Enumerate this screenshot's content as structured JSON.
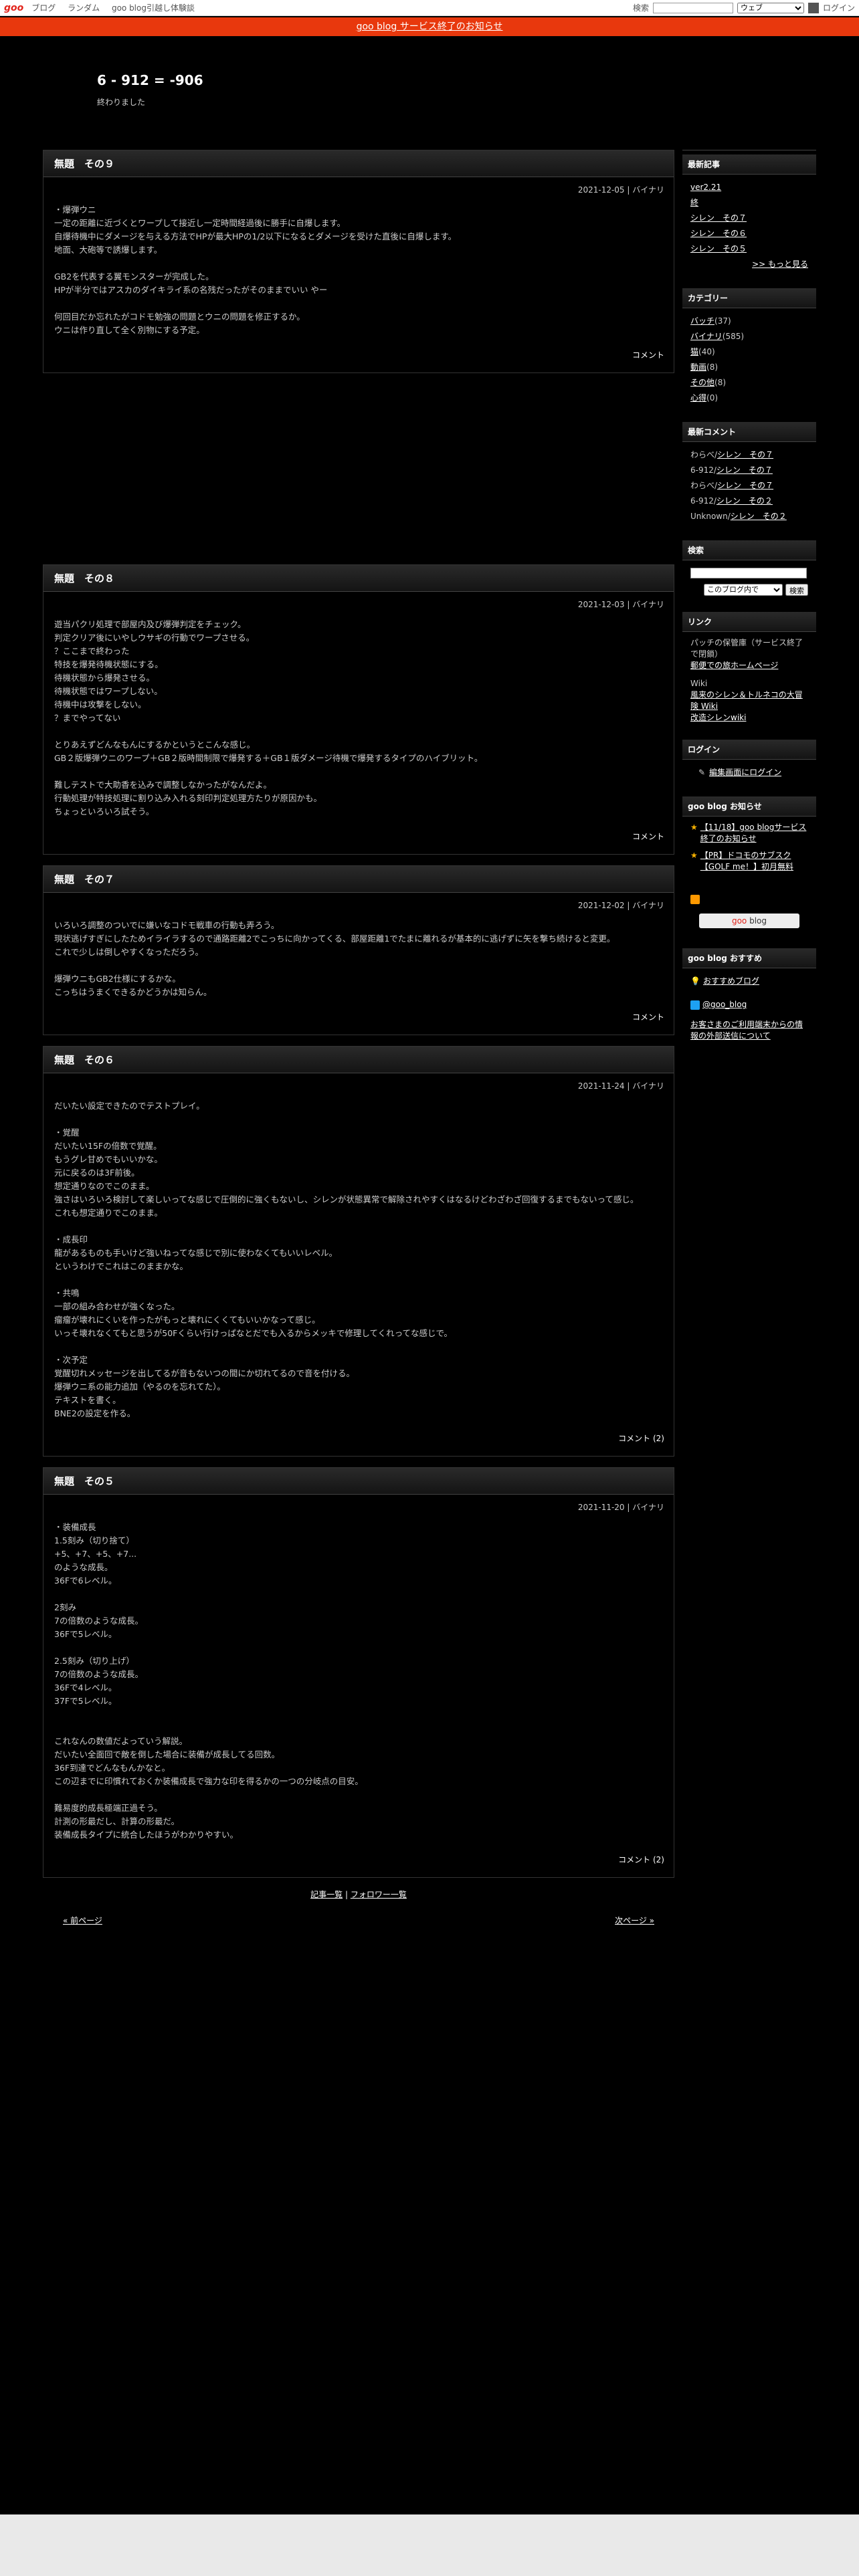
{
  "topbar": {
    "logo": "goo",
    "nav": [
      "ブログ",
      "ランダム",
      "goo blog引越し体験談"
    ],
    "search_label": "検索",
    "search_scope": "ウェブ",
    "login": "ログイン"
  },
  "notice": "goo blog サービス終了のお知らせ",
  "blog": {
    "title": "6 - 912 = -906",
    "description": "終わりました"
  },
  "entries": [
    {
      "title": "無題　その９",
      "meta": "2021-12-05 | バイナリ",
      "body": "・爆弾ウニ\n一定の距離に近づくとワープして接近し一定時間経過後に勝手に自爆します。\n自爆待機中にダメージを与える方法でHPが最大HPの1/2以下になるとダメージを受けた直後に自爆します。\n地面、大砲等で誘爆します。\n\nGB2を代表する翼モンスターが完成した。\nHPが半分ではアスカのダイキライ系の名残だったがそのままでいい やー\n\n何回目だか忘れたがコドモ勉強の問題とウニの問題を修正するか。\nウニは作り直して全く別物にする予定。",
      "footer": "コメント"
    },
    {
      "title": "無題　その８",
      "meta": "2021-12-03 | バイナリ",
      "body": "遊当パクリ処理で部屋内及び爆弾判定をチェック。\n判定クリア後にいやしウサギの行動でワープさせる。\n？ここまで終わった\n特技を爆発待機状態にする。\n待機状態から爆発させる。\n待機状態ではワープしない。\n待機中は攻撃をしない。\n？までやってない\n\nとりあえずどんなもんにするかというとこんな感じ。\nGB２版爆弾ウニのワープ＋GB２版時間制限で爆発する＋GB１版ダメージ待機で爆発するタイプのハイブリット。\n\n難しテストで大助香を込みで調整しなかったがなんだよ。\n行動処理が特技処理に割り込み入れる刻印判定処理方たりが原因かも。\nちょっといろいろ試そう。",
      "footer": "コメント"
    },
    {
      "title": "無題　その７",
      "meta": "2021-12-02 | バイナリ",
      "body": "いろいろ調整のついでに嫌いなコドモ戦車の行動も弄ろう。\n現状逃げすぎにしたためイライラするので通路距離2でこっちに向かってくる、部屋距離1でたまに離れるが基本的に逃げずに矢を撃ち続けると変更。\nこれで少しは倒しやすくなっただろう。\n\n爆弾ウニもGB2仕様にするかな。\nこっちはうまくできるかどうかは知らん。",
      "footer": "コメント"
    },
    {
      "title": "無題　その６",
      "meta": "2021-11-24 | バイナリ",
      "body": "だいたい設定できたのでテストプレイ。\n\n・覚醒\nだいたい15Fの倍数で覚醒。\nもうグレ甘めでもいいかな。\n元に戻るのは3F前後。\n想定通りなのでこのまま。\n強さはいろいろ検討して楽しいってな感じで圧倒的に強くもないし、シレンが状態異常で解除されやすくはなるけどわざわざ回復するまでもないって感じ。\nこれも想定通りでこのまま。\n\n・成長印\n龍があるものも手いけど強いねってな感じで別に使わなくてもいいレベル。\nというわけでこれはこのままかな。\n\n・共鳴\n一部の組み合わせが強くなった。\n瘤瘤が壊れにくいを作ったがもっと壊れにくくてもいいかなって感じ。\nいっそ壊れなくてもと思うが50Fくらい行けっぱなとだでも入るからメッキで修理してくれってな感じで。\n\n・次予定\n覚醒切れメッセージを出してるが音もないつの間にか切れてるので音を付ける。\n爆弾ウニ系の能力追加（やるのを忘れてた）。\nテキストを書く。\nBNE2の設定を作る。",
      "footer": "コメント (2)"
    },
    {
      "title": "無題　その５",
      "meta": "2021-11-20 | バイナリ",
      "body": "・装備成長\n1.5刻み（切り捨て）\n+5、+7、+5、+7...\nのような成長。\n36Fで6レベル。\n\n2刻み\n7の倍数のような成長。\n36Fで5レベル。\n\n2.5刻み（切り上げ）\n7の倍数のような成長。\n36Fで4レベル。\n37Fで5レベル。\n\n\nこれなんの数値だよっていう解説。\nだいたい全面回で敵を倒した場合に装備が成長してる回数。\n36F到達でどんなもんかなと。\nこの辺までに印慣れておくか装備成長で強力な印を得るかの一つの分岐点の目安。\n\n難易度的成長極端正過そう。\n計測の形最だし、計算の形最だ。\n装備成長タイプに統合したほうがわかりやすい。",
      "footer": "コメント (2)"
    }
  ],
  "bottom_links": {
    "list": "記事一覧",
    "sep": "|",
    "follow": "フォロワー一覧"
  },
  "pager": {
    "prev": "« 前ページ",
    "next": "次ページ »"
  },
  "sidebar": {
    "recent": {
      "title": "最新記事",
      "items": [
        "ver2.21",
        "終",
        "シレン　その７",
        "シレン　その６",
        "シレン　その５"
      ],
      "more": ">> もっと見る"
    },
    "categories": {
      "title": "カテゴリー",
      "items": [
        {
          "name": "バッチ",
          "count": "(37)"
        },
        {
          "name": "バイナリ",
          "count": "(585)"
        },
        {
          "name": "猫",
          "count": "(40)"
        },
        {
          "name": "動画",
          "count": "(8)"
        },
        {
          "name": "その他",
          "count": "(8)"
        },
        {
          "name": "心得",
          "count": "(0)"
        }
      ]
    },
    "comments": {
      "title": "最新コメント",
      "items": [
        {
          "who": "わらべ/",
          "post": "シレン　その７"
        },
        {
          "who": "6-912/",
          "post": "シレン　その７"
        },
        {
          "who": "わらべ/",
          "post": "シレン　その７"
        },
        {
          "who": "6-912/",
          "post": "シレン　その２"
        },
        {
          "who": "Unknown/",
          "post": "シレン　その２"
        }
      ]
    },
    "search": {
      "title": "検索",
      "scope": "このブログ内で",
      "button": "検索"
    },
    "links": {
      "title": "リンク",
      "lines": [
        "パッチの保管庫（サービス終了で閉鎖）",
        "郵便での旅ホームページ",
        "Wiki",
        "風来のシレン＆トルネコの大冒険 Wiki",
        "改造シレンwiki"
      ]
    },
    "login": {
      "title": "ログイン",
      "link": "編集画面にログイン"
    },
    "news": {
      "title": "goo blog お知らせ",
      "items": [
        "【11/18】goo blogサービス終了のお知らせ",
        "【PR】ドコモのサブスク【GOLF me！】初月無料"
      ]
    },
    "badge": {
      "g": "goo",
      "rest": " blog"
    },
    "recommend": {
      "title": "goo blog おすすめ",
      "item": "おすすめブログ"
    },
    "twitter": "@goo_blog",
    "external": "お客さまのご利用端末からの情報の外部送信について"
  }
}
